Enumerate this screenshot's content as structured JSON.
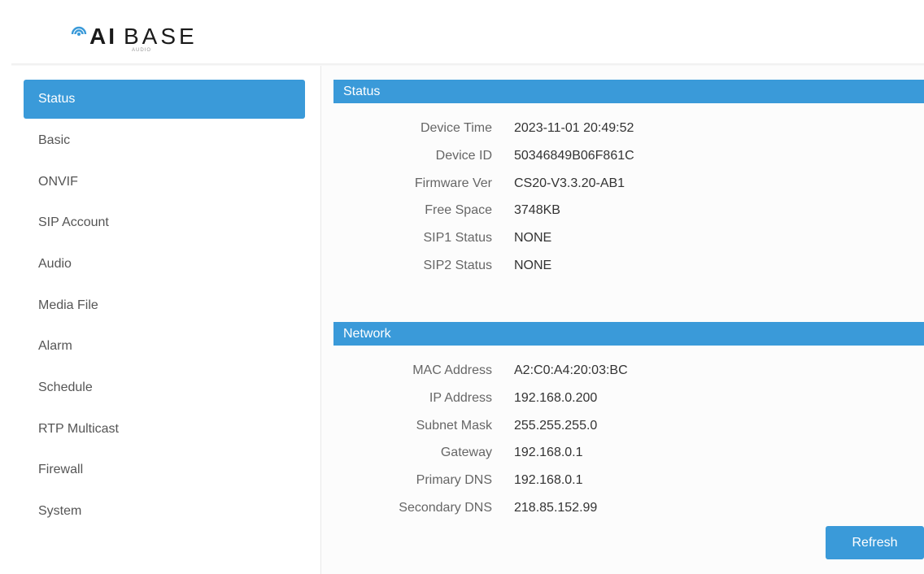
{
  "brand": {
    "name_bold": "AI",
    "name_light": "BASE",
    "sub": "AUDIO",
    "accent": "#3a9ad9"
  },
  "sidebar": {
    "items": [
      {
        "label": "Status",
        "active": true
      },
      {
        "label": "Basic"
      },
      {
        "label": "ONVIF"
      },
      {
        "label": "SIP Account"
      },
      {
        "label": "Audio"
      },
      {
        "label": "Media File"
      },
      {
        "label": "Alarm"
      },
      {
        "label": "Schedule"
      },
      {
        "label": "RTP Multicast"
      },
      {
        "label": "Firewall"
      },
      {
        "label": "System"
      }
    ]
  },
  "status": {
    "title": "Status",
    "rows": [
      {
        "label": "Device Time",
        "value": "2023-11-01 20:49:52"
      },
      {
        "label": "Device ID",
        "value": "50346849B06F861C"
      },
      {
        "label": "Firmware Ver",
        "value": "CS20-V3.3.20-AB1"
      },
      {
        "label": "Free Space",
        "value": "3748KB"
      },
      {
        "label": "SIP1 Status",
        "value": "NONE"
      },
      {
        "label": "SIP2 Status",
        "value": "NONE"
      }
    ]
  },
  "network": {
    "title": "Network",
    "rows": [
      {
        "label": "MAC Address",
        "value": "A2:C0:A4:20:03:BC"
      },
      {
        "label": "IP Address",
        "value": "192.168.0.200"
      },
      {
        "label": "Subnet Mask",
        "value": "255.255.255.0"
      },
      {
        "label": "Gateway",
        "value": "192.168.0.1"
      },
      {
        "label": "Primary DNS",
        "value": "192.168.0.1"
      },
      {
        "label": "Secondary DNS",
        "value": "218.85.152.99"
      }
    ]
  },
  "actions": {
    "refresh_label": "Refresh"
  }
}
